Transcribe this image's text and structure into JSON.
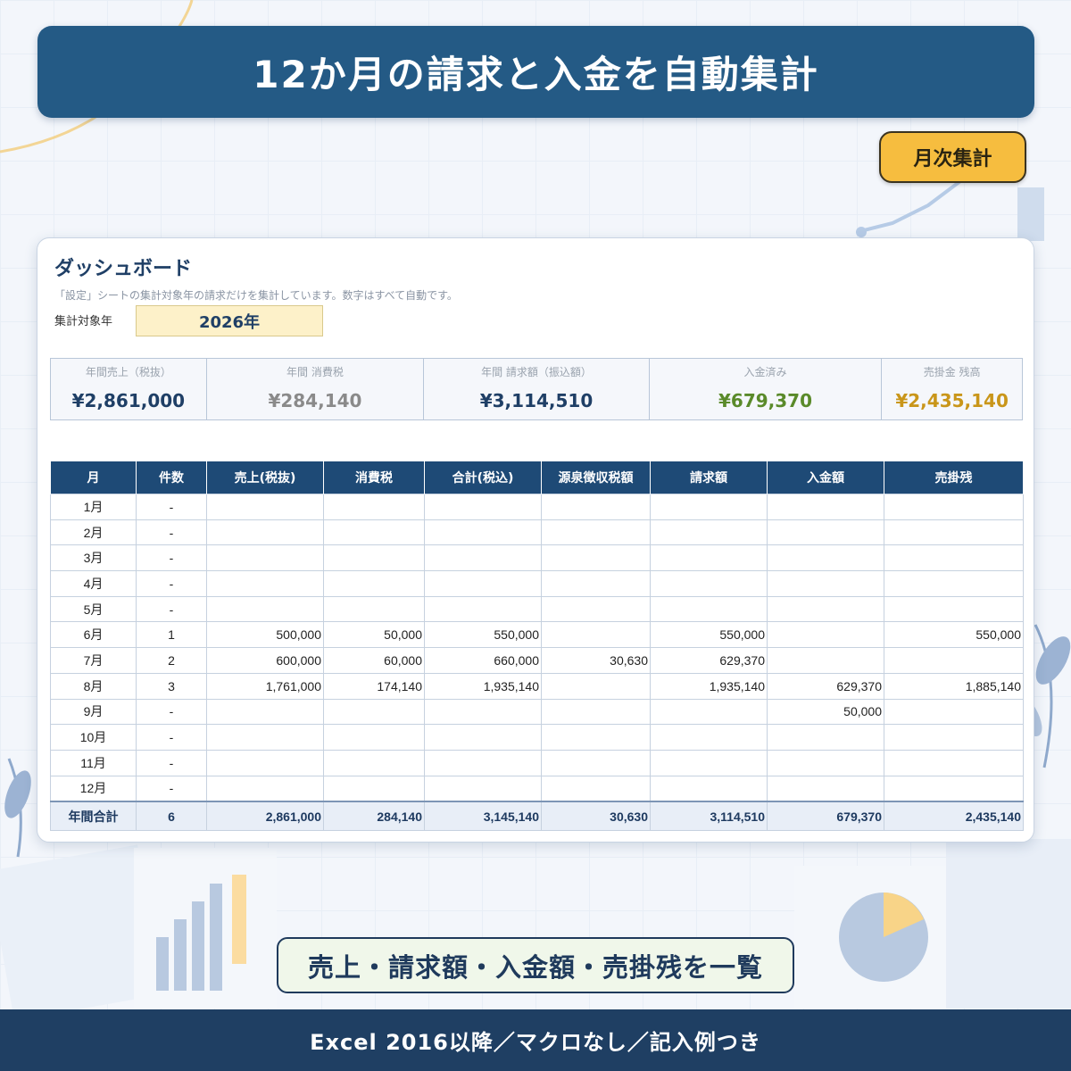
{
  "header": {
    "title": "12か月の請求と入金を自動集計"
  },
  "badge": {
    "label": "月次集計"
  },
  "dashboard": {
    "title": "ダッシュボード",
    "note": "「設定」シートの集計対象年の請求だけを集計しています。数字はすべて自動です。",
    "year_label": "集計対象年",
    "year_value": "2026年",
    "kpis": [
      {
        "label": "年間売上（税抜）",
        "value": "¥2,861,000",
        "color": "#1f3f66"
      },
      {
        "label": "年間 消費税",
        "value": "¥284,140",
        "color": "#8a8a8a"
      },
      {
        "label": "年間 請求額（振込額）",
        "value": "¥3,114,510",
        "color": "#1f3f66"
      },
      {
        "label": "入金済み",
        "value": "¥679,370",
        "color": "#5a8a2a"
      },
      {
        "label": "売掛金 残高",
        "value": "¥2,435,140",
        "color": "#c9961a"
      }
    ]
  },
  "table": {
    "headers": [
      "月",
      "件数",
      "売上(税抜)",
      "消費税",
      "合計(税込)",
      "源泉徴収税額",
      "請求額",
      "入金額",
      "売掛残"
    ],
    "rows": [
      [
        "1月",
        "-",
        "",
        "",
        "",
        "",
        "",
        "",
        ""
      ],
      [
        "2月",
        "-",
        "",
        "",
        "",
        "",
        "",
        "",
        ""
      ],
      [
        "3月",
        "-",
        "",
        "",
        "",
        "",
        "",
        "",
        ""
      ],
      [
        "4月",
        "-",
        "",
        "",
        "",
        "",
        "",
        "",
        ""
      ],
      [
        "5月",
        "-",
        "",
        "",
        "",
        "",
        "",
        "",
        ""
      ],
      [
        "6月",
        "1",
        "500,000",
        "50,000",
        "550,000",
        "",
        "550,000",
        "",
        "550,000"
      ],
      [
        "7月",
        "2",
        "600,000",
        "60,000",
        "660,000",
        "30,630",
        "629,370",
        "",
        ""
      ],
      [
        "8月",
        "3",
        "1,761,000",
        "174,140",
        "1,935,140",
        "",
        "1,935,140",
        "629,370",
        "1,885,140"
      ],
      [
        "9月",
        "-",
        "",
        "",
        "",
        "",
        "",
        "50,000",
        ""
      ],
      [
        "10月",
        "-",
        "",
        "",
        "",
        "",
        "",
        "",
        ""
      ],
      [
        "11月",
        "-",
        "",
        "",
        "",
        "",
        "",
        "",
        ""
      ],
      [
        "12月",
        "-",
        "",
        "",
        "",
        "",
        "",
        "",
        ""
      ]
    ],
    "total": [
      "年間合計",
      "6",
      "2,861,000",
      "284,140",
      "3,145,140",
      "30,630",
      "3,114,510",
      "679,370",
      "2,435,140"
    ]
  },
  "bottom_pill": {
    "label": "売上・請求額・入金額・売掛残を一覧"
  },
  "footer": {
    "label": "Excel 2016以降／マクロなし／記入例つき"
  }
}
